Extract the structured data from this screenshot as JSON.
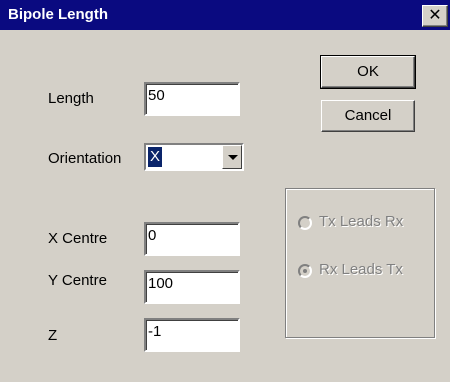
{
  "window": {
    "title": "Bipole Length",
    "close_glyph": "✕"
  },
  "fields": {
    "length": {
      "label": "Length",
      "value": "50"
    },
    "orientation": {
      "label": "Orientation",
      "value": "X"
    },
    "x_centre": {
      "label": "X Centre",
      "value": "0"
    },
    "y_centre": {
      "label": "Y Centre",
      "value": "100"
    },
    "z": {
      "label": "Z",
      "value": "-1"
    }
  },
  "buttons": {
    "ok": "OK",
    "cancel": "Cancel"
  },
  "leads": {
    "options": [
      {
        "label": "Tx Leads Rx",
        "checked": false
      },
      {
        "label": "Rx Leads Tx",
        "checked": true
      }
    ],
    "enabled": false
  },
  "colors": {
    "titlebar": "#0a0a80",
    "dialog_face": "#d4d0c8",
    "selection": "#0a246a"
  }
}
